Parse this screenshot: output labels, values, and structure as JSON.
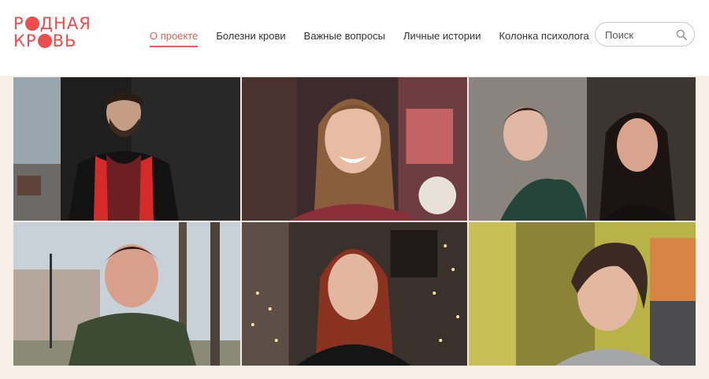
{
  "logo": {
    "line1": "Р",
    "line1_rest": "ДНАЯ",
    "line2": "КР",
    "line2_rest": "ВЬ",
    "full": "РОДНАЯ КРОВЬ"
  },
  "nav": [
    {
      "label": "О проекте",
      "active": true
    },
    {
      "label": "Болезни крови",
      "active": false
    },
    {
      "label": "Важные вопросы",
      "active": false
    },
    {
      "label": "Личные истории",
      "active": false
    },
    {
      "label": "Колонка психолога",
      "active": false
    }
  ],
  "search": {
    "placeholder": "Поиск"
  },
  "colors": {
    "accent": "#e85d57",
    "band": "#f9efe9"
  },
  "photos": [
    {
      "name": "man-in-red-jacket-photo"
    },
    {
      "name": "young-woman-smiling-photo"
    },
    {
      "name": "two-women-photo"
    },
    {
      "name": "man-in-park-photo"
    },
    {
      "name": "woman-with-lights-photo"
    },
    {
      "name": "woman-short-hair-photo"
    }
  ]
}
